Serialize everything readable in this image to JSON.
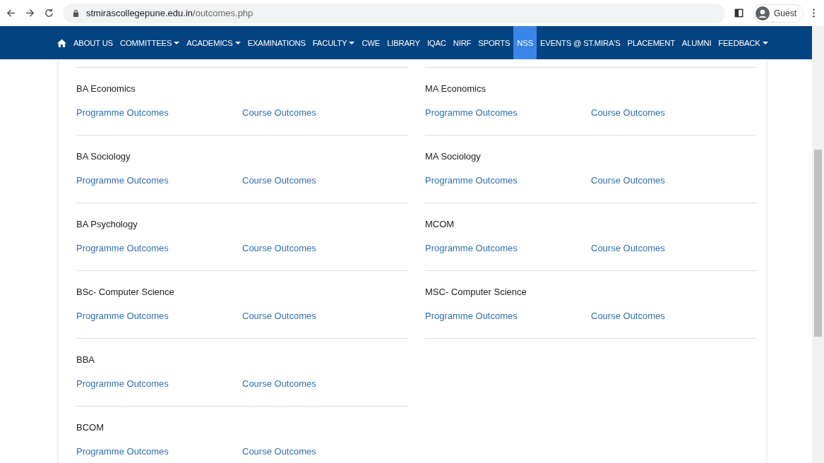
{
  "browser": {
    "url_host": "stmirascollegepune.edu.in",
    "url_path": "/outcomes.php",
    "profile": "Guest"
  },
  "nav": {
    "items": [
      {
        "label": "ABOUT US",
        "dropdown": false,
        "selected": false
      },
      {
        "label": "COMMITTEES",
        "dropdown": true,
        "selected": false
      },
      {
        "label": "ACADEMICS",
        "dropdown": true,
        "selected": false
      },
      {
        "label": "EXAMINATIONS",
        "dropdown": false,
        "selected": false
      },
      {
        "label": "FACULTY",
        "dropdown": true,
        "selected": false
      },
      {
        "label": "CWE",
        "dropdown": false,
        "selected": false
      },
      {
        "label": "LIBRARY",
        "dropdown": false,
        "selected": false
      },
      {
        "label": "IQAC",
        "dropdown": false,
        "selected": false
      },
      {
        "label": "NIRF",
        "dropdown": false,
        "selected": false
      },
      {
        "label": "SPORTS",
        "dropdown": false,
        "selected": false
      },
      {
        "label": "NSS",
        "dropdown": false,
        "selected": true
      },
      {
        "label": "EVENTS @ ST.MIRA'S",
        "dropdown": false,
        "selected": false
      },
      {
        "label": "PLACEMENT",
        "dropdown": false,
        "selected": false
      },
      {
        "label": "ALUMNI",
        "dropdown": false,
        "selected": false
      },
      {
        "label": "FEEDBACK",
        "dropdown": true,
        "selected": false
      }
    ]
  },
  "programmes": {
    "columns": [
      [
        {
          "name": "BA Economics",
          "links": [
            "Programme Outcomes",
            "Course Outcomes"
          ]
        },
        {
          "name": "BA Sociology",
          "links": [
            "Programme Outcomes",
            "Course Outcomes"
          ]
        },
        {
          "name": "BA Psychology",
          "links": [
            "Programme Outcomes",
            "Course Outcomes"
          ]
        },
        {
          "name": "BSc- Computer Science",
          "links": [
            "Programme Outcomes",
            "Course Outcomes"
          ]
        },
        {
          "name": "BBA",
          "links": [
            "Programme Outcomes",
            "Course Outcomes"
          ]
        },
        {
          "name": "BCOM",
          "links": [
            "Programme Outcomes",
            "Course Outcomes"
          ]
        }
      ],
      [
        {
          "name": "MA Economics",
          "links": [
            "Programme Outcomes",
            "Course Outcomes"
          ]
        },
        {
          "name": "MA Sociology",
          "links": [
            "Programme Outcomes",
            "Course Outcomes"
          ]
        },
        {
          "name": "MCOM",
          "links": [
            "Programme Outcomes",
            "Course Outcomes"
          ]
        },
        {
          "name": "MSC- Computer Science",
          "links": [
            "Programme Outcomes",
            "Course Outcomes"
          ]
        }
      ]
    ]
  }
}
